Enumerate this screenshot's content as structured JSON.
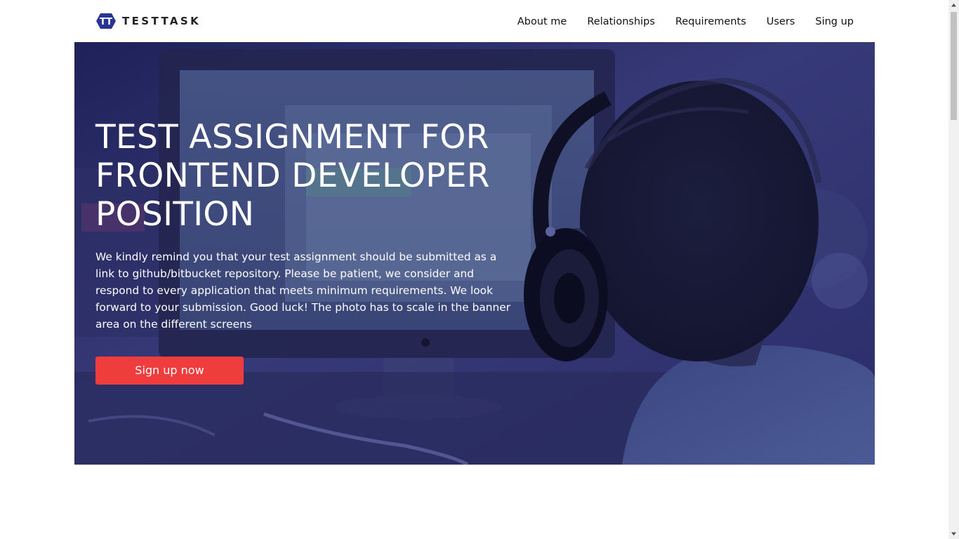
{
  "header": {
    "logo_text": "TESTTASK",
    "logo_mark": "TT",
    "nav": [
      {
        "label": "About me"
      },
      {
        "label": "Relationships"
      },
      {
        "label": "Requirements"
      },
      {
        "label": "Users"
      },
      {
        "label": "Sing up"
      }
    ]
  },
  "banner": {
    "headline": "TEST ASSIGNMENT FOR FRONTEND DEVELOPER POSITION",
    "text": "We kindly remind you that your test assignment should be submitted as a link to github/bitbucket repository. Please be patient, we consider and respond to every application that meets minimum requirements. We look forward to your submission. Good luck! The photo has to scale in the banner area on the different screens",
    "cta_label": "Sign up now",
    "background_image": "photo of a person wearing headphones in front of a monitor",
    "overlay_color": "#2a2c6e"
  },
  "colors": {
    "accent": "#ef3c3c",
    "logo": "#283593",
    "text": "#111111"
  }
}
